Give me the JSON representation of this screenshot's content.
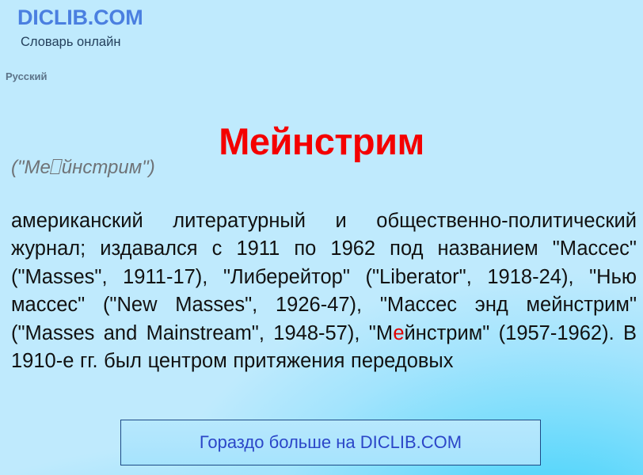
{
  "site": {
    "brand": "DICLIB.COM",
    "tagline": "Словарь онлайн",
    "language": "Русский"
  },
  "entry": {
    "headword": "Мейнстрим",
    "transcription_prefix": "(\"Ме",
    "transcription_missing_glyph": "missing-glyph-box",
    "transcription_suffix": "йнстрим\")",
    "definition_part_1": "американский литературный и общественно-политический журнал; издавался с 1911 по 1962 под названием \"Массес\" (\"Masses\", 1911-17), \"Либерейтор\" (\"Liberator\", 1918-24), \"Нью массес\" (\"New Masses\", 1926-47), \"Массес энд мейнстрим\" (\"Masses and Mainstream\", 1948-57), \"М",
    "definition_highlight": "е",
    "definition_part_2": "йнстрим\" (1957-1962). В 1910-е гг. был центром притяжения передовых"
  },
  "cta": {
    "label": "Гораздо больше на DICLIB.COM"
  },
  "colors": {
    "brand_blue": "#4a7fe0",
    "headword_red": "#f40000",
    "highlight_red": "#e00000",
    "cta_text_blue": "#2b46c8",
    "cta_border_blue": "#1c4a86",
    "background_pale_blue": "#bfeafd",
    "background_cyan": "#46d2fb",
    "tagline_navy": "#24405c",
    "language_gray": "#5d7489",
    "transcription_gray": "#6f7377",
    "body_text": "#111111"
  }
}
